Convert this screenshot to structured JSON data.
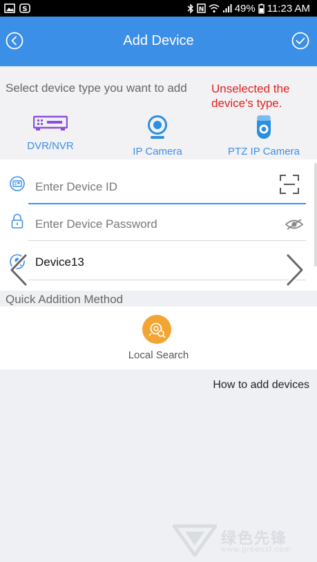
{
  "status_bar": {
    "battery": "49%",
    "time": "11:23 AM"
  },
  "header": {
    "title": "Add Device"
  },
  "device_type": {
    "prompt": "Select device type you want to add",
    "warning": "Unselected the device's type.",
    "types": [
      {
        "label": "DVR/NVR",
        "icon": "dvr-icon"
      },
      {
        "label": "IP Camera",
        "icon": "ip-camera-icon"
      },
      {
        "label": "PTZ IP Camera",
        "icon": "ptz-camera-icon"
      }
    ]
  },
  "form": {
    "device_id_placeholder": "Enter Device ID",
    "password_placeholder": "Enter Device Password",
    "device_name": "Device13"
  },
  "quick": {
    "title": "Quick Addition Method",
    "local_search": "Local Search"
  },
  "help_link": "How to add devices",
  "watermark": {
    "text": "绿色先锋",
    "sub": "www.greenxf.com"
  },
  "colors": {
    "accent": "#3c8fe6",
    "warning": "#e02020",
    "search_circle": "#f2a531"
  }
}
